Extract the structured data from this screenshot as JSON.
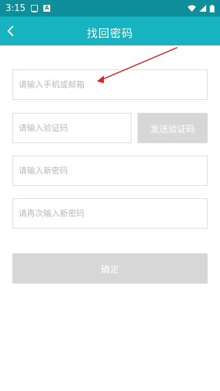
{
  "status_bar": {
    "time": "3:15",
    "icons": [
      "image-icon",
      "a-icon",
      "wifi-icon",
      "signal-icon",
      "battery-icon"
    ]
  },
  "header": {
    "title": "找回密码",
    "back_icon": "back-chevron-icon"
  },
  "form": {
    "phone_or_email_placeholder": "请输入手机或邮箱",
    "verification_code_placeholder": "请输入验证码",
    "send_code_label": "发送验证码",
    "new_password_placeholder": "请输入新密码",
    "confirm_password_placeholder": "请再次输入新密码",
    "submit_label": "确定"
  },
  "colors": {
    "status_bar_bg": "#0f8f9b",
    "header_bg": "#18b3c0",
    "disabled_button_bg": "#d7d7d7",
    "annotation_arrow": "#d62828"
  }
}
